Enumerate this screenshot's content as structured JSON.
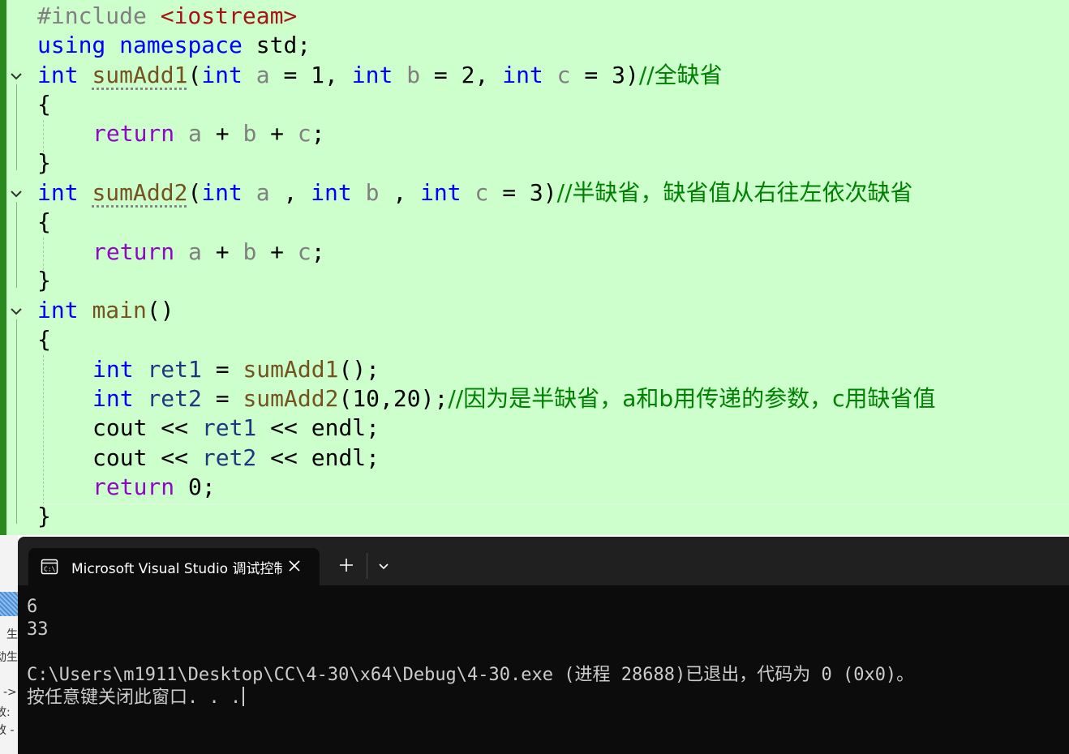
{
  "editor": {
    "include": {
      "directive": "#include",
      "header": "<iostream>"
    },
    "using_line": {
      "kw1": "using",
      "kw2": "namespace",
      "rest": " std;"
    },
    "sumadd1_sig": {
      "ret_type": "int",
      "name": "sumAdd1",
      "open": "(",
      "t1": "int",
      "p1": "a",
      "v1": " = 1, ",
      "t2": "int",
      "p2": "b",
      "v2": " = 2, ",
      "t3": "int",
      "p3": "c",
      "v3": " = 3)",
      "comment": "//全缺省"
    },
    "sumadd2_sig": {
      "ret_type": "int",
      "name": "sumAdd2",
      "open": "(",
      "t1": "int",
      "p1": "a",
      "v1": " , ",
      "t2": "int",
      "p2": "b",
      "v2": " , ",
      "t3": "int",
      "p3": "c",
      "v3": " = 3)",
      "comment": "//半缺省，缺省值从右往左依次缺省"
    },
    "open_brace": "{",
    "close_brace": "}",
    "return_stmt": {
      "kw": "return",
      "a": "a",
      "op1": " + ",
      "b": "b",
      "op2": " + ",
      "c": "c",
      "end": ";"
    },
    "main_sig": {
      "ret_type": "int",
      "name": "main",
      "parens": "()"
    },
    "ret1_line": {
      "type": "int",
      "var": "ret1",
      "eq": " = ",
      "call": "sumAdd1",
      "rest": "();"
    },
    "ret2_line": {
      "type": "int",
      "var": "ret2",
      "eq": " = ",
      "call": "sumAdd2",
      "rest": "(10,20);",
      "comment": "//因为是半缺省，a和b用传递的参数，c用缺省值"
    },
    "cout1": {
      "pre": "cout << ",
      "var": "ret1",
      "post": " << endl;"
    },
    "cout2": {
      "pre": "cout << ",
      "var": "ret2",
      "post": " << endl;"
    },
    "return0": {
      "kw": "return",
      "rest": " 0;"
    }
  },
  "terminal": {
    "tab_title": "Microsoft Visual Studio 调试控制台",
    "output": [
      "6",
      "33",
      "",
      "C:\\Users\\m1911\\Desktop\\CC\\4-30\\x64\\Debug\\4-30.exe (进程 28688)已退出，代码为 0 (0x0)。",
      "按任意键关闭此窗口. . ."
    ]
  },
  "background_window": {
    "fragments": [
      "生",
      "动生",
      "->",
      "故:",
      "改 -"
    ]
  },
  "colors": {
    "editor_bg": "#ccffcc",
    "keyword": "#0000ff",
    "control_keyword": "#8f08c4",
    "function": "#74531f",
    "parameter": "#808080",
    "local_var": "#1f377f",
    "comment": "#008000",
    "string": "#a31515",
    "terminal_bg": "#0c0c0c",
    "tab_bar": "#202020"
  },
  "icons": [
    "collapse-chevron-icon",
    "console-icon",
    "close-icon",
    "plus-icon",
    "chevron-down-icon"
  ]
}
